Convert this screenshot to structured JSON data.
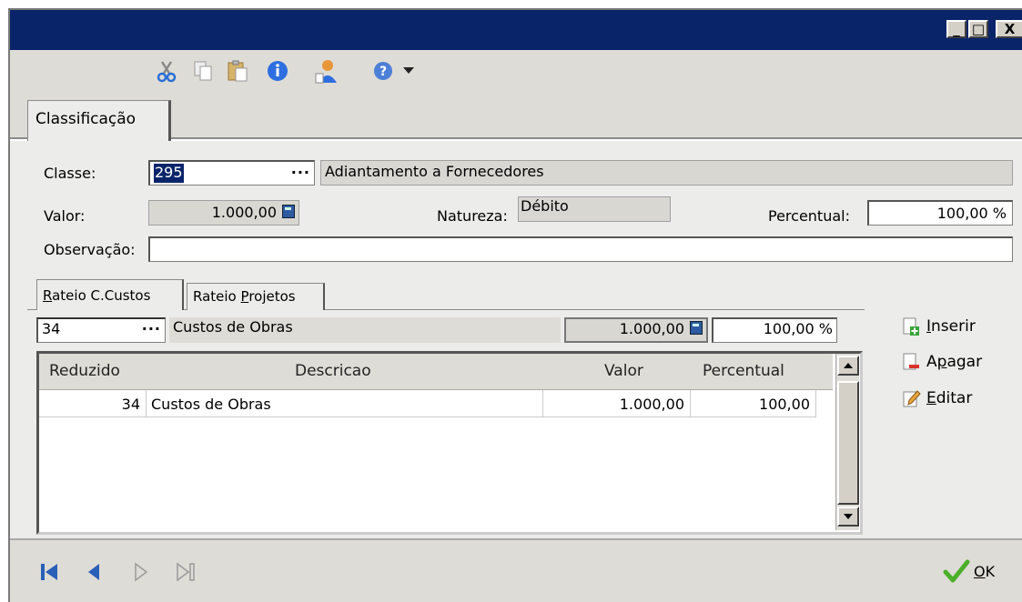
{
  "window": {
    "controls": [
      "_",
      "□",
      "X"
    ]
  },
  "toolbar": {
    "icons": [
      "cut-icon",
      "copy-icon",
      "paste-icon",
      "info-icon",
      "user-icon",
      "help-icon",
      "dropdown-arrow-icon"
    ]
  },
  "tabs": {
    "main": "Classificação"
  },
  "form": {
    "classe_label": "Classe:",
    "classe_code": "295",
    "classe_lookup": "···",
    "classe_desc": "Adiantamento a Fornecedores",
    "valor_label": "Valor:",
    "valor_value": "1.000,00",
    "natureza_label": "Natureza:",
    "natureza_value": "Débito",
    "percentual_label": "Percentual:",
    "percentual_value": "100,00 %",
    "observacao_label": "Observação:",
    "observacao_value": ""
  },
  "subtabs": {
    "custos_prefix": "R",
    "custos_rest": "ateio C.Custos",
    "projetos_prefix": "Rateio ",
    "projetos_u": "P",
    "projetos_rest": "rojetos"
  },
  "rateio": {
    "code": "34",
    "lookup": "···",
    "desc": "Custos de Obras",
    "valor": "1.000,00",
    "percentual": "100,00 %"
  },
  "grid": {
    "headers": [
      "Reduzido",
      "Descricao",
      "Valor",
      "Percentual"
    ],
    "rows": [
      {
        "reduzido": "34",
        "descricao": "Custos de Obras",
        "valor": "1.000,00",
        "percentual": "100,00"
      }
    ]
  },
  "actions": {
    "inserir_u": "I",
    "inserir_rest": "nserir",
    "apagar_pre": "A",
    "apagar_u": "p",
    "apagar_rest": "agar",
    "editar_u": "E",
    "editar_rest": "ditar"
  },
  "footer": {
    "ok_u": "O",
    "ok_rest": "K"
  },
  "colors": {
    "titlebar": "#0a246a",
    "panel": "#ececea",
    "toolbar": "#dedcd6",
    "ok_check": "#4caf2a"
  }
}
